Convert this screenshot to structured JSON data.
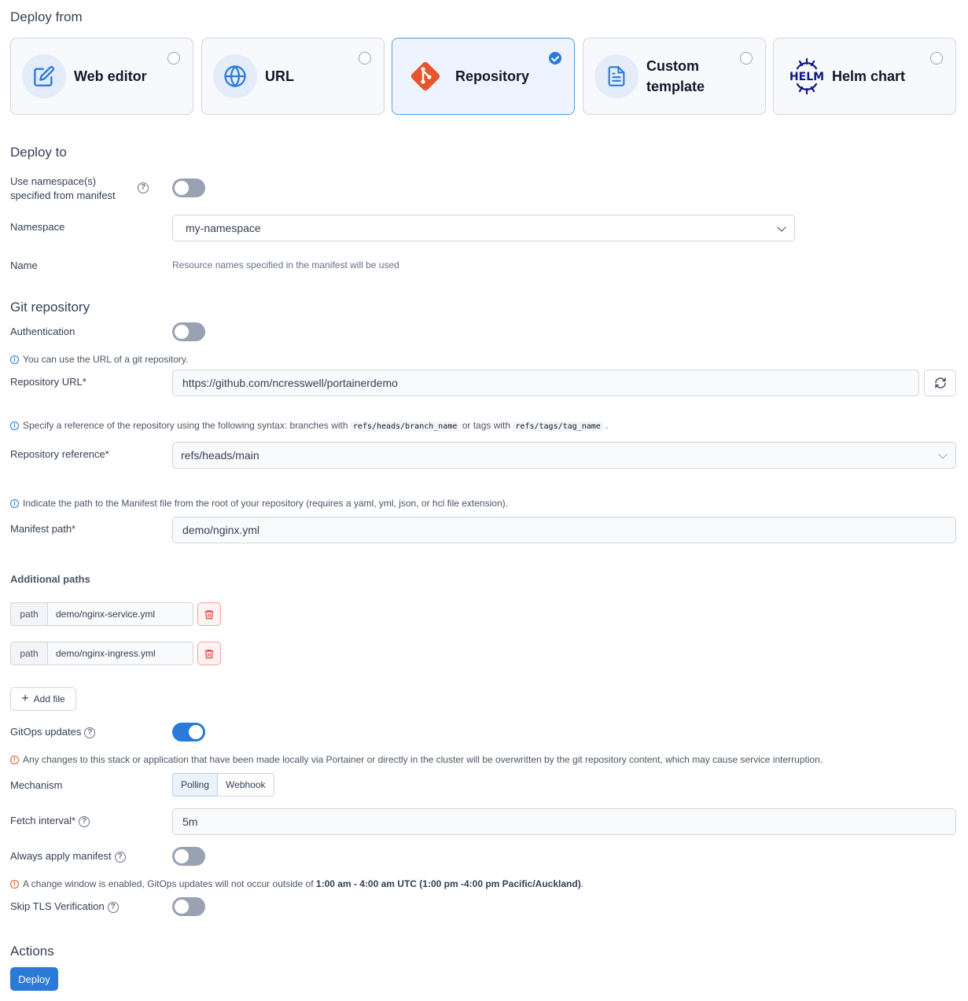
{
  "deploy_from": {
    "title": "Deploy from",
    "options": [
      {
        "label": "Web editor",
        "icon": "edit-icon",
        "selected": false
      },
      {
        "label": "URL",
        "icon": "globe-icon",
        "selected": false
      },
      {
        "label": "Repository",
        "icon": "git-icon",
        "selected": true
      },
      {
        "label_line1": "Custom",
        "label_line2": "template",
        "icon": "file-icon",
        "selected": false
      },
      {
        "label": "Helm chart",
        "icon": "helm-icon",
        "icon_text": "HELM",
        "selected": false
      }
    ]
  },
  "deploy_to": {
    "title": "Deploy to",
    "use_namespace_label_line1": "Use namespace(s)",
    "use_namespace_label_line2": "specified from manifest",
    "use_namespace_on": false,
    "namespace_label": "Namespace",
    "namespace_value": "my-namespace",
    "name_label": "Name",
    "name_hint": "Resource names specified in the manifest will be used"
  },
  "git": {
    "title": "Git repository",
    "auth_label": "Authentication",
    "auth_on": false,
    "url_info": "You can use the URL of a git repository.",
    "url_label": "Repository URL*",
    "url_value": "https://github.com/ncresswell/portainerdemo",
    "ref_info_prefix": "Specify a reference of the repository using the following syntax: branches with",
    "ref_info_code1": "refs/heads/branch_name",
    "ref_info_mid": "or tags with",
    "ref_info_code2": "refs/tags/tag_name",
    "ref_info_suffix": ".",
    "ref_label": "Repository reference*",
    "ref_value": "refs/heads/main",
    "manifest_info": "Indicate the path to the Manifest file from the root of your repository (requires a yaml, yml, json, or hcl file extension).",
    "manifest_label": "Manifest path*",
    "manifest_value": "demo/nginx.yml"
  },
  "additional_paths": {
    "title": "Additional paths",
    "addon_label": "path",
    "paths": [
      "demo/nginx-service.yml",
      "demo/nginx-ingress.yml"
    ],
    "add_file_label": "Add file"
  },
  "gitops": {
    "label": "GitOps updates",
    "on": true,
    "warning": "Any changes to this stack or application that have been made locally via Portainer or directly in the cluster will be overwritten by the git repository content, which may cause service interruption.",
    "mechanism_label": "Mechanism",
    "mechanism_options": [
      "Polling",
      "Webhook"
    ],
    "mechanism_selected": "Polling",
    "fetch_label": "Fetch interval*",
    "fetch_value": "5m",
    "always_apply_label": "Always apply manifest",
    "always_apply_on": false,
    "change_window_prefix": "A change window is enabled, GitOps updates will not occur outside of",
    "change_window_bold": "1:00 am - 4:00 am UTC (1:00 pm -4:00 pm Pacific/Auckland)",
    "change_window_suffix": ".",
    "skip_tls_label": "Skip TLS Verification",
    "skip_tls_on": false
  },
  "actions": {
    "title": "Actions",
    "deploy_label": "Deploy"
  },
  "colors": {
    "accent": "#2a7ad8",
    "git_orange": "#e8542e",
    "helm_navy": "#0f1689",
    "danger": "#e53935"
  }
}
